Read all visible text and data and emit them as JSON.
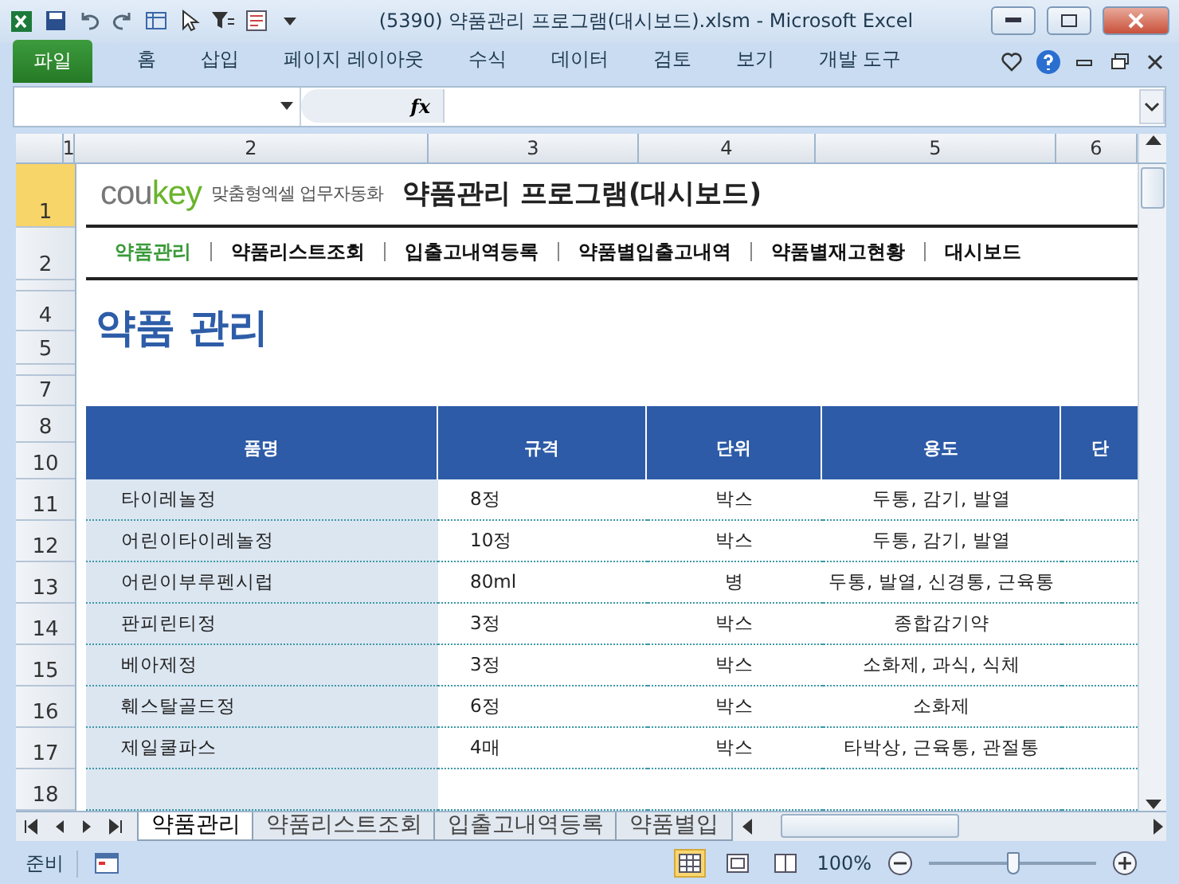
{
  "window": {
    "title": "(5390) 약품관리 프로그램(대시보드).xlsm  -  Microsoft Excel"
  },
  "file_tab": "파일",
  "ribbon_tabs": [
    "홈",
    "삽입",
    "페이지 레이아웃",
    "수식",
    "데이터",
    "검토",
    "보기",
    "개발 도구"
  ],
  "formula_bar": {
    "function_label": "fx"
  },
  "column_headers": [
    "1",
    "2",
    "3",
    "4",
    "5",
    "6"
  ],
  "row_headers": [
    {
      "label": "1",
      "kind": "title",
      "selected": true
    },
    {
      "label": "2",
      "kind": "nav",
      "selected": false
    },
    {
      "kind": "sliver"
    },
    {
      "label": "4",
      "kind": "head",
      "selected": false
    },
    {
      "label": "5",
      "kind": "head2",
      "selected": false
    },
    {
      "kind": "sliver"
    },
    {
      "label": "7",
      "kind": "blank",
      "selected": false
    },
    {
      "label": "8",
      "kind": "thead",
      "selected": false
    },
    {
      "label": "10",
      "kind": "thead",
      "selected": false
    },
    {
      "label": "11",
      "kind": "data",
      "selected": false
    },
    {
      "label": "12",
      "kind": "data",
      "selected": false
    },
    {
      "label": "13",
      "kind": "data",
      "selected": false
    },
    {
      "label": "14",
      "kind": "data",
      "selected": false
    },
    {
      "label": "15",
      "kind": "data",
      "selected": false
    },
    {
      "label": "16",
      "kind": "data",
      "selected": false
    },
    {
      "label": "17",
      "kind": "data",
      "selected": false
    },
    {
      "label": "18",
      "kind": "data",
      "selected": false
    }
  ],
  "banner": {
    "logo_a": "cou",
    "logo_b": "key",
    "slogan": "맞춤형엑셀 업무자동화",
    "title": "약품관리 프로그램(대시보드)"
  },
  "nav": [
    {
      "label": "약품관리",
      "selected": true
    },
    {
      "label": "약품리스트조회",
      "selected": false
    },
    {
      "label": "입출고내역등록",
      "selected": false
    },
    {
      "label": "약품별입출고내역",
      "selected": false
    },
    {
      "label": "약품별재고현황",
      "selected": false
    },
    {
      "label": "대시보드",
      "selected": false
    }
  ],
  "heading": "약품 관리",
  "table": {
    "columns": [
      "품명",
      "규격",
      "단위",
      "용도",
      "단"
    ],
    "rows": [
      [
        "타이레놀정",
        "8정",
        "박스",
        "두통, 감기, 발열"
      ],
      [
        "어린이타이레놀정",
        "10정",
        "박스",
        "두통, 감기, 발열"
      ],
      [
        "어린이부루펜시럽",
        "80ml",
        "병",
        "두통, 발열, 신경통, 근육통"
      ],
      [
        "판피린티정",
        "3정",
        "박스",
        "종합감기약"
      ],
      [
        "베아제정",
        "3정",
        "박스",
        "소화제, 과식, 식체"
      ],
      [
        "훼스탈골드정",
        "6정",
        "박스",
        "소화제"
      ],
      [
        "제일쿨파스",
        "4매",
        "박스",
        "타박상, 근육통, 관절통"
      ],
      [
        "",
        "",
        "",
        ""
      ]
    ]
  },
  "sheet_tabs": [
    {
      "label": "약품관리",
      "selected": true
    },
    {
      "label": "약품리스트조회",
      "selected": false
    },
    {
      "label": "입출고내역등록",
      "selected": false
    },
    {
      "label": "약품별입",
      "selected": false
    }
  ],
  "status_bar": {
    "status": "준비",
    "zoom": "100%",
    "zoom_slider": {
      "level": 0.5
    }
  }
}
